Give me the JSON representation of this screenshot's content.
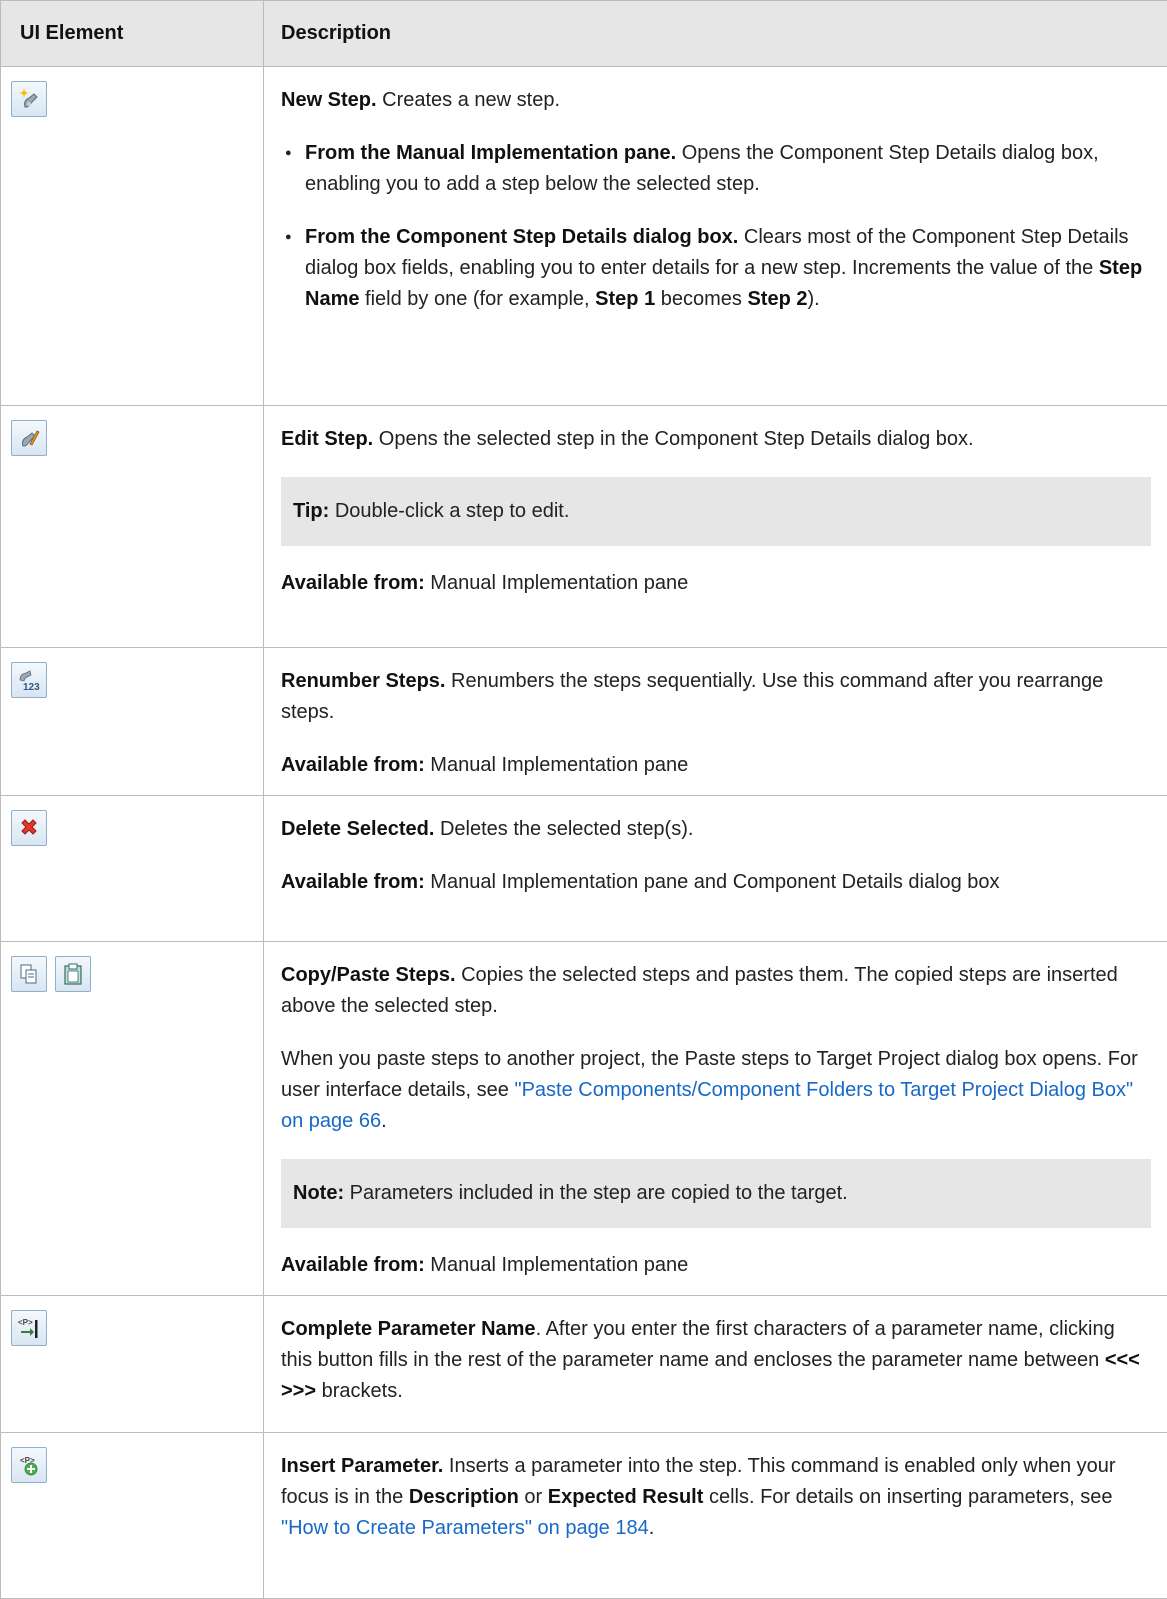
{
  "header": {
    "col1": "UI Element",
    "col2": "Description"
  },
  "rows": {
    "new_step": {
      "icon": "new-step-icon",
      "title": "New Step.",
      "text": " Creates a new step.",
      "b1_title": "From the Manual Implementation pane.",
      "b1_text": " Opens the Component Step Details dialog box, enabling you to add a step below the selected step.",
      "b2_title": "From the Component Step Details dialog box.",
      "b2_text1": " Clears most of the Component Step Details dialog box fields, enabling you to enter details for a new step. Increments the value of the ",
      "b2_bold1": "Step Name",
      "b2_text2": " field by one (for example, ",
      "b2_bold2": "Step 1",
      "b2_text3": " becomes ",
      "b2_bold3": "Step 2",
      "b2_text4": ")."
    },
    "edit_step": {
      "icon": "edit-step-icon",
      "title": "Edit Step.",
      "text": " Opens the selected step in the Component Step Details dialog box.",
      "tip_label": "Tip:",
      "tip_text": " Double-click a step to edit.",
      "avail_label": "Available from:",
      "avail_text": " Manual Implementation pane"
    },
    "renumber": {
      "icon": "renumber-steps-icon",
      "title": "Renumber Steps.",
      "text": " Renumbers the steps sequentially. Use this command after you rearrange steps.",
      "avail_label": "Available from:",
      "avail_text": " Manual Implementation pane"
    },
    "delete": {
      "icon": "delete-icon",
      "title": "Delete Selected.",
      "text": " Deletes the selected step(s).",
      "avail_label": "Available from:",
      "avail_text": " Manual Implementation pane and Component Details dialog box"
    },
    "copy_paste": {
      "icons": [
        "copy-icon",
        "paste-icon"
      ],
      "title": "Copy/Paste Steps.",
      "text": " Copies the selected steps and pastes them. The copied steps are inserted above the selected step.",
      "p2_text": "When you paste steps to another project, the Paste steps to Target Project dialog box opens. For user interface details, see ",
      "p2_link": "\"Paste Components/Component Folders to Target Project Dialog Box\" on page 66",
      "p2_end": ".",
      "note_label": "Note:",
      "note_text": " Parameters included in the step are copied to the target.",
      "avail_label": "Available from:",
      "avail_text": " Manual Implementation pane"
    },
    "complete_param": {
      "icon": "complete-parameter-icon",
      "title": "Complete Parameter Name",
      "text1": ". After you enter the first characters of a parameter name, clicking this button fills in the rest of the parameter name and encloses the parameter name between ",
      "brackets": "<<< >>>",
      "text2": " brackets."
    },
    "insert_param": {
      "icon": "insert-parameter-icon",
      "title": "Insert Parameter.",
      "text1": " Inserts a parameter into the step. This command is enabled only when your focus is in the ",
      "bold1": "Description",
      "text2": " or ",
      "bold2": "Expected Result",
      "text3": " cells. For details on inserting parameters, see ",
      "link": "\"How to Create Parameters\" on page 184",
      "end": "."
    }
  },
  "colors": {
    "header_bg": "#e6e6e6",
    "note_bg": "#e6e6e6",
    "link": "#1769c8",
    "border": "#bbbbbb"
  }
}
